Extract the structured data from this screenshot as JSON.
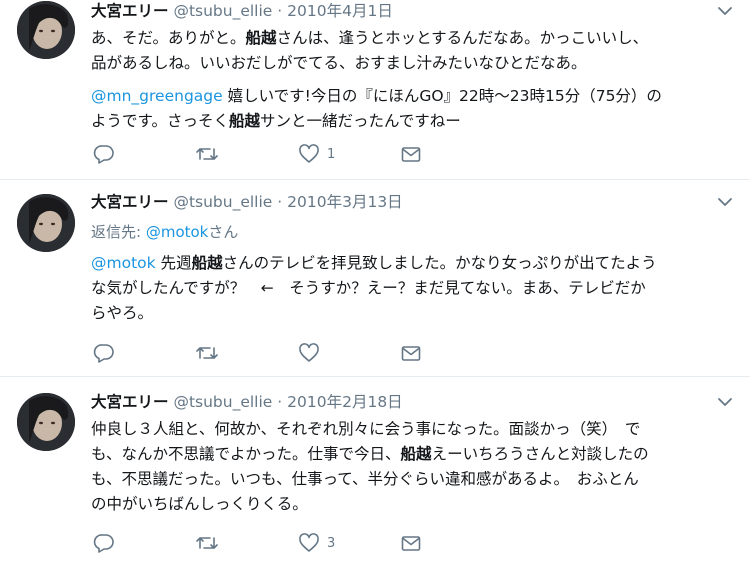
{
  "tweets": [
    {
      "name": "大宮エリー",
      "handle": "@tsubu_ellie",
      "separator": "·",
      "date": "2010年4月1日",
      "reply_to_label": "",
      "reply_to_handle": "",
      "reply_to_suffix": "",
      "lines": [
        {
          "pre": "あ、そだ。ありがと。",
          "bold": "船越",
          "post": "さんは、逢うとホッとするんだなあ。かっこいいし、"
        },
        {
          "pre": "品があるしね。いいおだしがでてる、おすまし汁みたいなひとだなあ。",
          "bold": "",
          "post": ""
        }
      ],
      "lines2": [
        {
          "mention": "@mn_greengage",
          "pre": " 嬉しいです!今日の『にほんGO』22時〜23時15分（75分）の",
          "bold": "",
          "post": ""
        },
        {
          "mention": "",
          "pre": "ようです。さっそく",
          "bold": "船越",
          "post": "サンと一緒だったんですねー"
        }
      ],
      "reply_count": "",
      "retweet_count": "",
      "like_count": "1"
    },
    {
      "name": "大宮エリー",
      "handle": "@tsubu_ellie",
      "separator": "·",
      "date": "2010年3月13日",
      "reply_to_label": "返信先: ",
      "reply_to_handle": "@motok",
      "reply_to_suffix": "さん",
      "lines": [
        {
          "mention": "@motok",
          "pre": " 先週",
          "bold": "船越",
          "post": "さんのテレビを拝見致しました。かなり女っぷりが出てたよう"
        },
        {
          "mention": "",
          "pre": "な気がしたんですが？　←　そうすか？えー？まだ見てない。まあ、テレビだか",
          "bold": "",
          "post": ""
        },
        {
          "mention": "",
          "pre": "らやろ。",
          "bold": "",
          "post": ""
        }
      ],
      "reply_count": "",
      "retweet_count": "",
      "like_count": ""
    },
    {
      "name": "大宮エリー",
      "handle": "@tsubu_ellie",
      "separator": "·",
      "date": "2010年2月18日",
      "lines": [
        {
          "pre": "仲良し３人組と、何故か、それぞれ別々に会う事になった。面談かっ（笑）　で",
          "bold": "",
          "post": ""
        },
        {
          "pre": "も、なんか不思議でよかった。仕事で今日、",
          "bold": "船越",
          "post": "えーいちろうさんと対談したの"
        },
        {
          "pre": "も、不思議だった。いつも、仕事って、半分ぐらい違和感があるよ。　おふとん",
          "bold": "",
          "post": ""
        },
        {
          "pre": "の中がいちばんしっくりくる。",
          "bold": "",
          "post": ""
        }
      ],
      "reply_count": "",
      "retweet_count": "",
      "like_count": "3"
    }
  ],
  "icons": [
    "reply-icon",
    "retweet-icon",
    "like-icon",
    "message-icon",
    "chevron-down-icon"
  ],
  "colors": {
    "text": "#14171a",
    "secondary": "#657786",
    "link": "#1b95e0",
    "divider": "#e6ecf0"
  }
}
